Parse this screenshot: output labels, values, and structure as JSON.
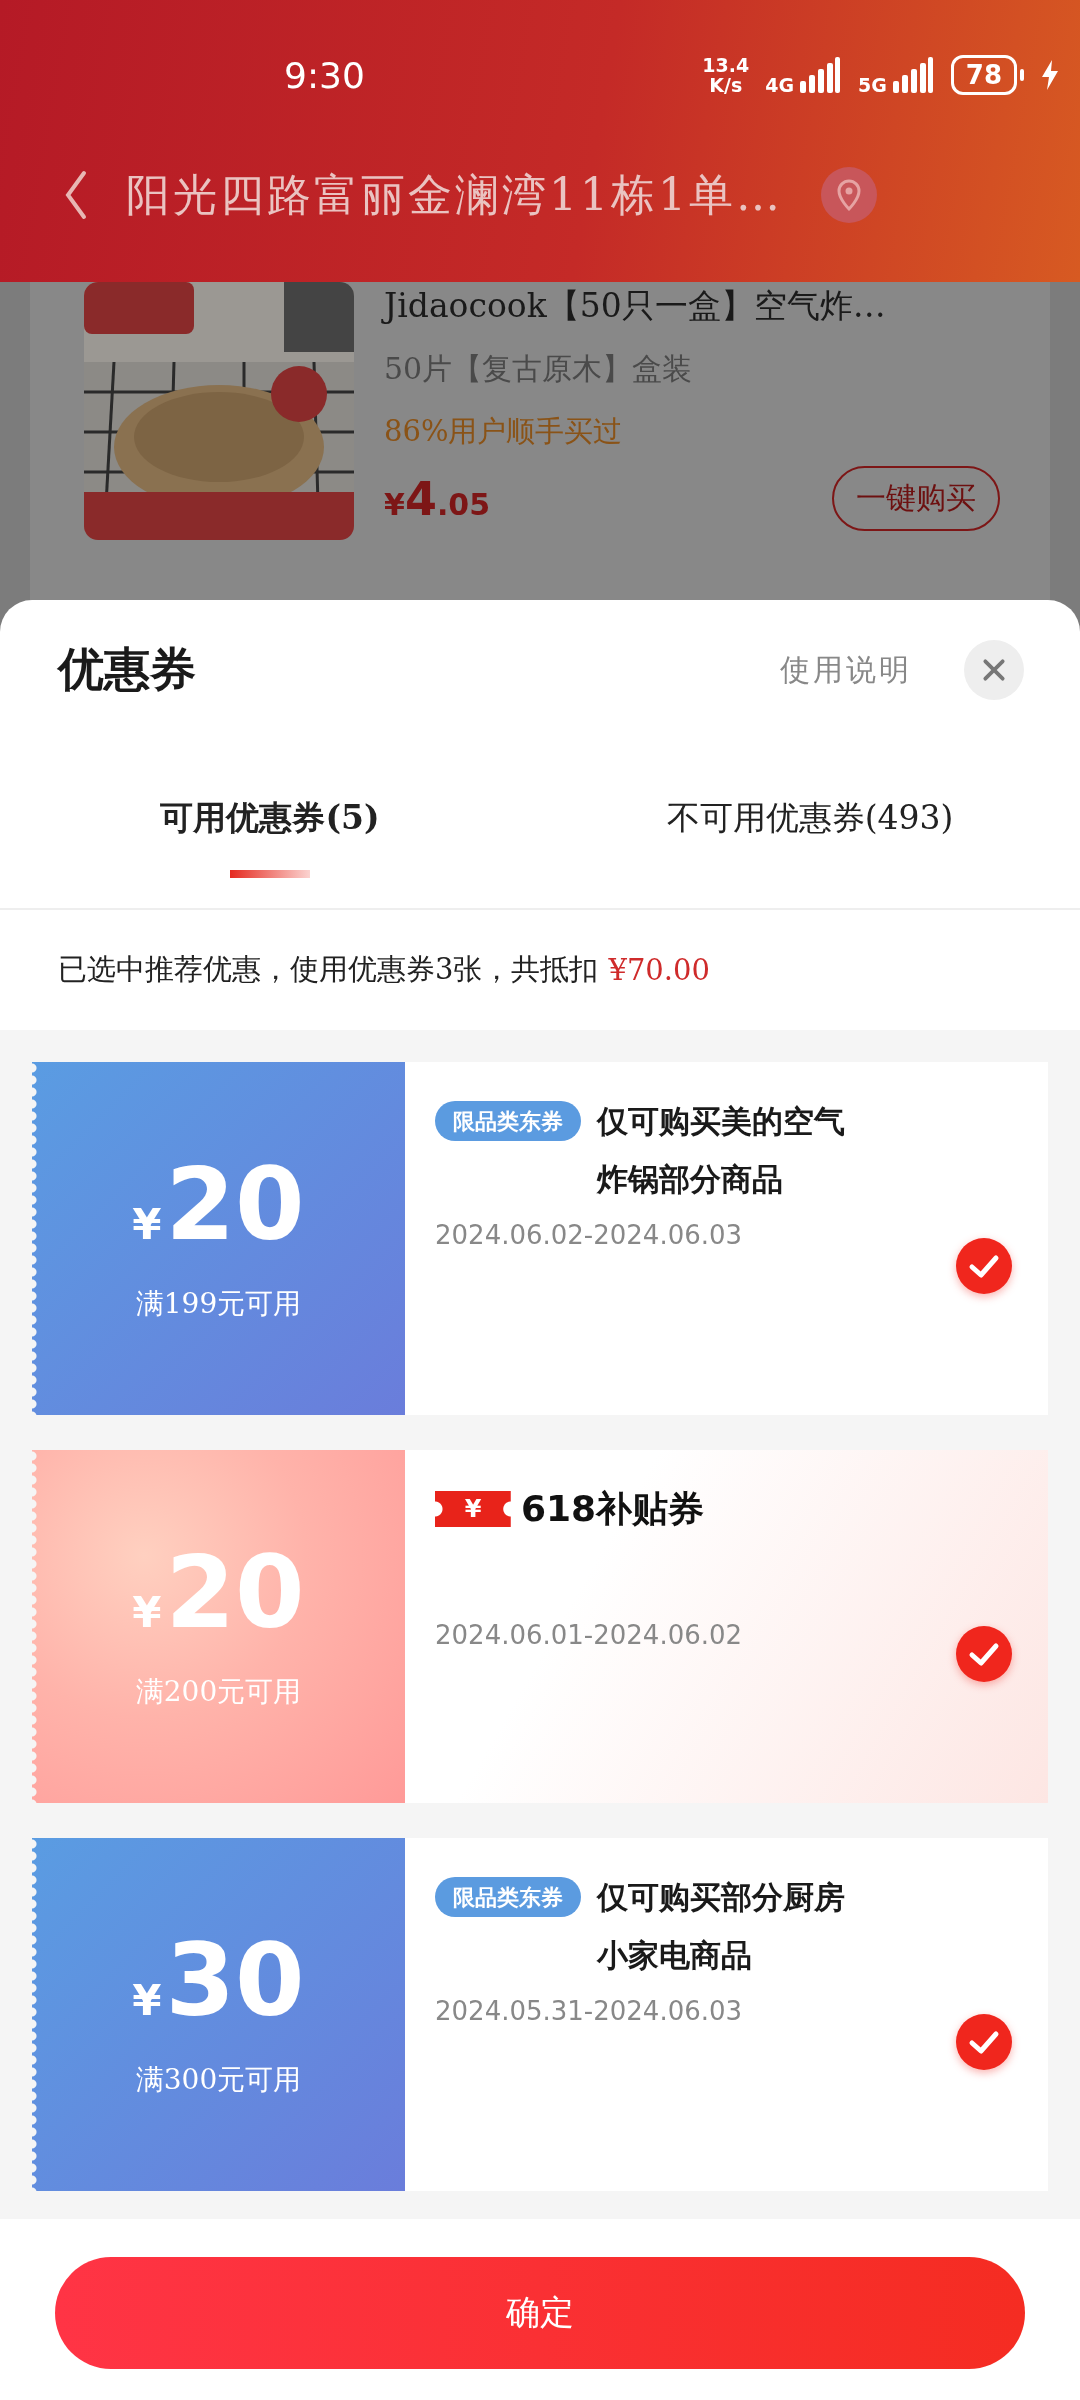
{
  "status_bar": {
    "time": "9:30",
    "net_speed": "13.4",
    "net_unit": "K/s",
    "network_1": "4G",
    "network_2": "5G",
    "battery": "78"
  },
  "header": {
    "address": "阳光四路富丽金澜湾11栋1单…"
  },
  "product": {
    "kind": "picture",
    "title": "Jidaocook【50只一盒】空气炸…",
    "variant": "50片【复古原木】盒装",
    "social_proof": "86%用户顺手买过",
    "price_symbol": "¥",
    "price_int": "4",
    "price_dec": ".05",
    "buy_button": "一键购买"
  },
  "sheet": {
    "title": "优惠券",
    "help_link": "使用说明"
  },
  "tabs": [
    {
      "label": "可用优惠券(5)",
      "selected": true
    },
    {
      "label": "不可用优惠券(493)",
      "selected": false
    }
  ],
  "summary": {
    "text": "已选中推荐优惠，使用优惠券3张，共抵扣",
    "amount": "¥70.00"
  },
  "coupons": [
    {
      "kind": "category",
      "currency": "¥",
      "amount": "20",
      "condition": "满199元可用",
      "tag": "限品类东券",
      "description": "仅可购买美的空气炸锅部分商品",
      "validity": "2024.06.02-2024.06.03",
      "selected": true
    },
    {
      "kind": "subsidy",
      "currency": "¥",
      "amount": "20",
      "condition": "满200元可用",
      "badge_symbol": "¥",
      "badge_label": "618补贴券",
      "validity": "2024.06.01-2024.06.02",
      "selected": true
    },
    {
      "kind": "category",
      "currency": "¥",
      "amount": "30",
      "condition": "满300元可用",
      "tag": "限品类东券",
      "description": "仅可购买部分厨房小家电商品",
      "validity": "2024.05.31-2024.06.03",
      "selected": true
    }
  ],
  "confirm_button": "确定"
}
